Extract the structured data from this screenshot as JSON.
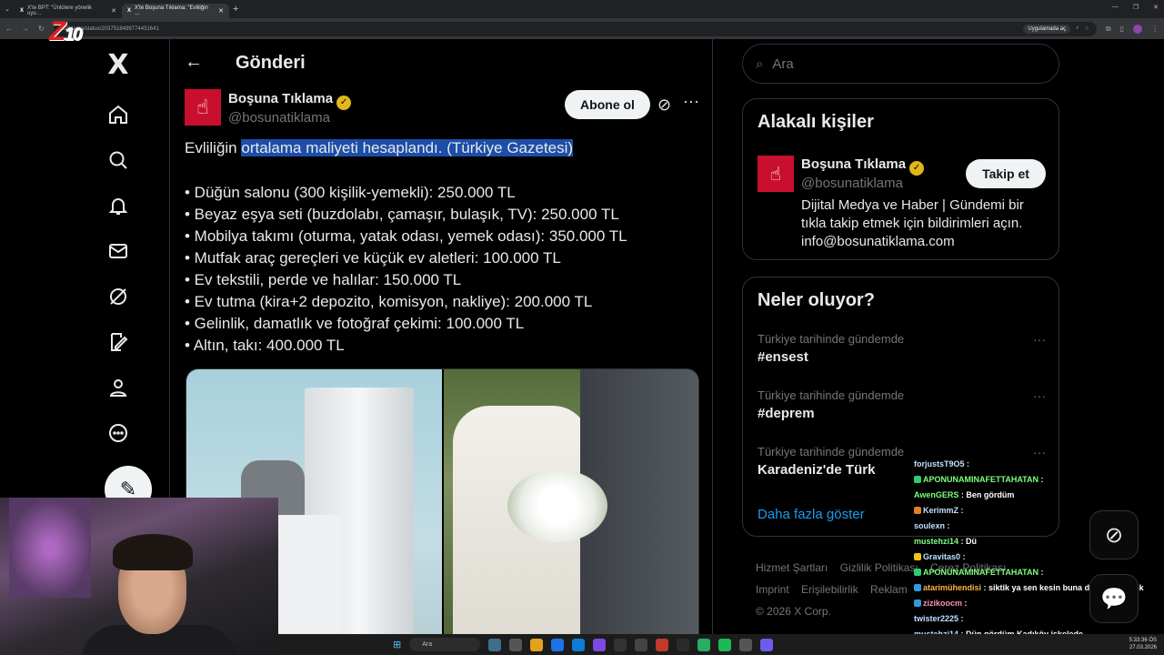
{
  "browser": {
    "tabs": [
      {
        "label": "X'te BPT: \"Ünlülere yönelik uyu…"
      },
      {
        "label": "X'te Boşuna Tıklama: \"Evliliğin …"
      }
    ],
    "url": "nstiklama/status/2037518499774431641",
    "open_app_label": "Uygulamada aç"
  },
  "overlay_logo": {
    "main": "Z",
    "sub": "10"
  },
  "main": {
    "page_title": "Gönderi",
    "author": {
      "name": "Boşuna Tıklama",
      "handle": "@bosunatiklama",
      "subscribe_label": "Abone ol"
    },
    "tweet": {
      "intro_plain": "Evliliğin ",
      "intro_highlight": "ortalama maliyeti hesaplandı. (Türkiye Gazetesi)",
      "items": [
        "• Düğün salonu (300 kişilik-yemekli): 250.000 TL",
        "• Beyaz eşya seti (buzdolabı, çamaşır, bulaşık, TV): 250.000 TL",
        "• Mobilya takımı (oturma, yatak odası, yemek odası): 350.000 TL",
        "• Mutfak araç gereçleri ve küçük ev aletleri: 100.000 TL",
        "• Ev tekstili, perde ve halılar: 150.000 TL",
        "• Ev tutma (kira+2 depozito, komisyon, nakliye): 200.000 TL",
        "• Gelinlik, damatlık ve fotoğraf çekimi: 100.000 TL",
        "• Altın, takı: 400.000 TL"
      ]
    }
  },
  "sidebar": {
    "search_placeholder": "Ara",
    "related": {
      "title": "Alakalı kişiler",
      "name": "Boşuna Tıklama",
      "handle": "@bosunatiklama",
      "follow_label": "Takip et",
      "bio": "Dijital Medya ve Haber | Gündemi bir tıkla takip etmek için bildirimleri açın. info@bosunatiklama.com"
    },
    "trends": {
      "title": "Neler oluyor?",
      "items": [
        {
          "meta": "Türkiye tarihinde gündemde",
          "name": "#ensest"
        },
        {
          "meta": "Türkiye tarihinde gündemde",
          "name": "#deprem"
        },
        {
          "meta": "Türkiye tarihinde gündemde",
          "name": "Karadeniz'de Türk"
        }
      ],
      "show_more": "Daha fazla göster"
    },
    "footer": {
      "links": [
        "Hizmet Şartları",
        "Gizlilik Politikası",
        "Çerez Politikası",
        "Imprint",
        "Erişilebilirlik",
        "Reklam"
      ],
      "copyright": "© 2026 X Corp."
    }
  },
  "chat": [
    {
      "user": "forjustsT9O5",
      "msg": ""
    },
    {
      "user": "APONUNAMINAFETTAHATAN",
      "msg": ""
    },
    {
      "user": "AwenGERS",
      "msg": "Ben gördüm"
    },
    {
      "user": "KerimmZ",
      "msg": ""
    },
    {
      "user": "soulexn",
      "msg": ""
    },
    {
      "user": "mustehzi14",
      "msg": "Dü"
    },
    {
      "user": "Gravitas0",
      "msg": ""
    },
    {
      "user": "APONUNAMINAFETTAHATAN",
      "msg": ""
    },
    {
      "user": "atarimühendisi",
      "msg": "siktik ya sen kesin buna da gidicen amk"
    },
    {
      "user": "zizikoocm",
      "msg": ""
    },
    {
      "user": "twister2225",
      "msg": ""
    },
    {
      "user": "mustehzi14",
      "msg": "Dün gördüm Kadıköy iskelede"
    }
  ],
  "taskbar": {
    "search_label": "Ara",
    "time": "5:33:36 ÖS",
    "date": "27.03.2026"
  },
  "colors": {
    "accent": "#1d9bf0",
    "brand_red": "#c8102e",
    "highlight": "#1d4ea8",
    "verified_gold": "#e2b719"
  }
}
